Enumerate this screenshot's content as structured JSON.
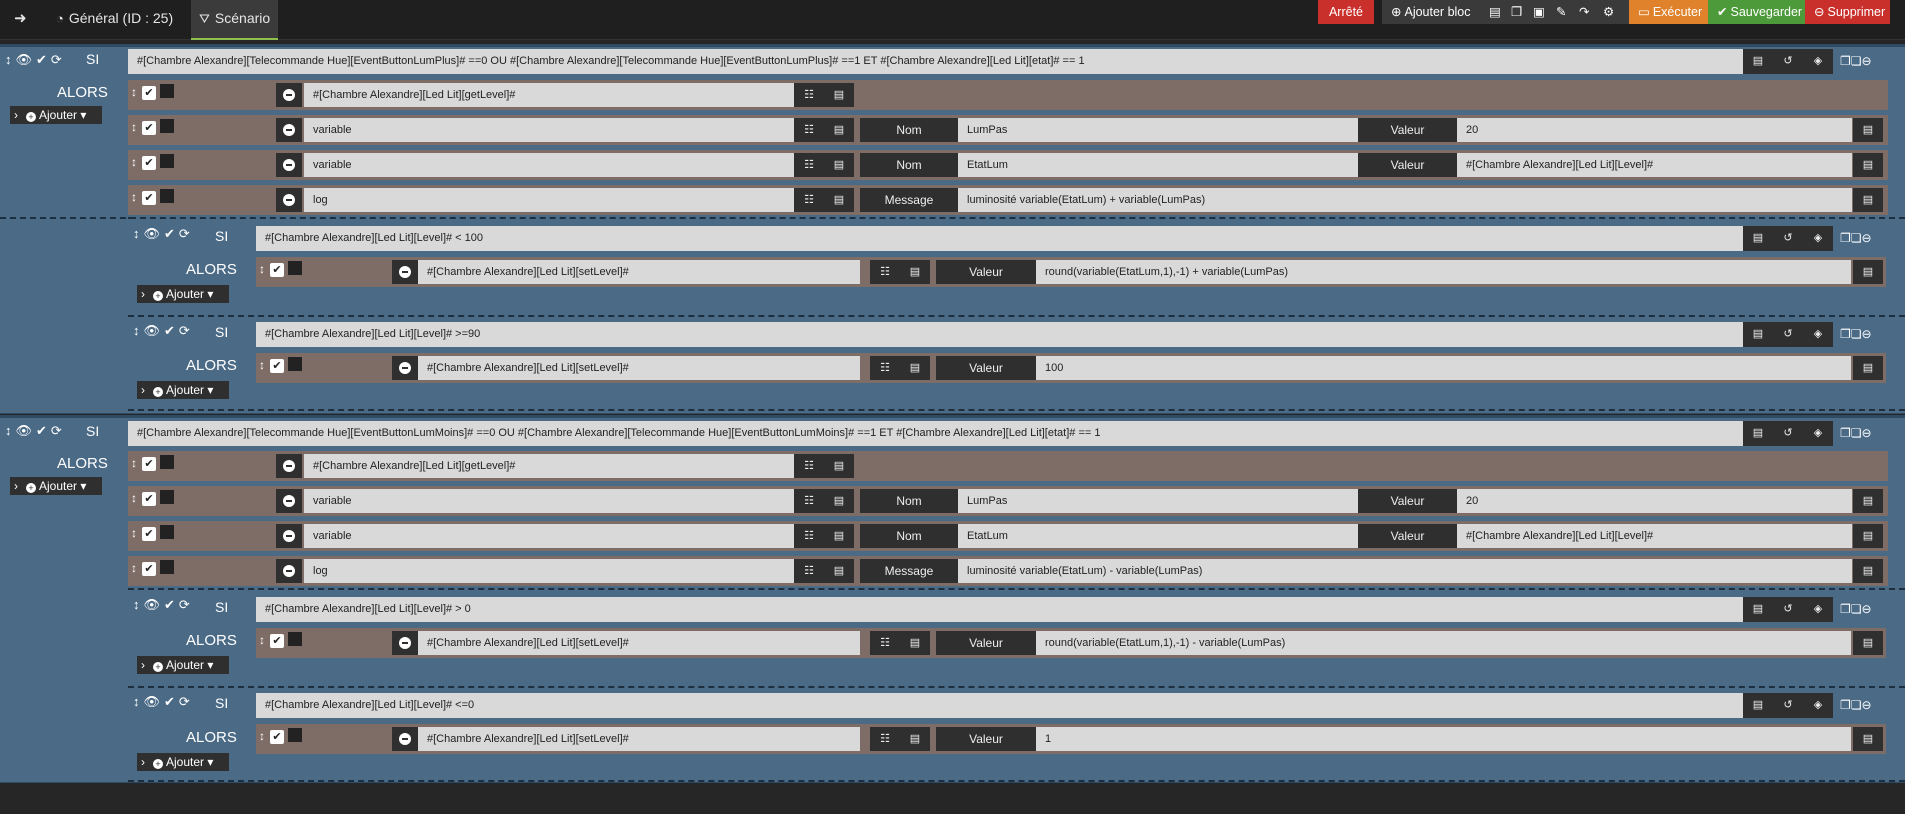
{
  "topbar": {
    "back_icon": "arrow-left-icon",
    "general_label": "Général (ID : 25)",
    "scenario_label": "Scénario",
    "status": "Arrêté",
    "add_block": "Ajouter bloc",
    "execute": "Exécuter",
    "save": "Sauvegarder",
    "delete": "Supprimer",
    "colors": {
      "status": "#c9302c",
      "execute": "#e0822b",
      "save": "#4c9a3a",
      "delete": "#c9302c"
    }
  },
  "labels": {
    "si": "SI",
    "alors": "ALORS",
    "add": "Ajouter",
    "nom": "Nom",
    "valeur": "Valeur",
    "message": "Message"
  },
  "blocks": [
    {
      "condition": "#[Chambre Alexandre][Telecommande Hue][EventButtonLumPlus]# ==0 OU #[Chambre Alexandre][Telecommande Hue][EventButtonLumPlus]# ==1 ET #[Chambre Alexandre][Led Lit][etat]# == 1",
      "actions": [
        {
          "cmd": "#[Chambre Alexandre][Led Lit][getLevel]#"
        },
        {
          "cmd": "variable",
          "nom": "LumPas",
          "valeur": "20"
        },
        {
          "cmd": "variable",
          "nom": "EtatLum",
          "valeur": "#[Chambre Alexandre][Led Lit][Level]#"
        },
        {
          "cmd": "log",
          "message": "luminosité variable(EtatLum) + variable(LumPas)"
        }
      ],
      "subs": [
        {
          "condition": "#[Chambre Alexandre][Led Lit][Level]# < 100",
          "action": {
            "cmd": "#[Chambre Alexandre][Led Lit][setLevel]#",
            "valeur": "round(variable(EtatLum,1),-1) + variable(LumPas)"
          }
        },
        {
          "condition": "#[Chambre Alexandre][Led Lit][Level]# >=90",
          "action": {
            "cmd": "#[Chambre Alexandre][Led Lit][setLevel]#",
            "valeur": "100"
          }
        }
      ]
    },
    {
      "condition": "#[Chambre Alexandre][Telecommande Hue][EventButtonLumMoins]# ==0 OU #[Chambre Alexandre][Telecommande Hue][EventButtonLumMoins]# ==1 ET #[Chambre Alexandre][Led Lit][etat]# == 1",
      "actions": [
        {
          "cmd": "#[Chambre Alexandre][Led Lit][getLevel]#"
        },
        {
          "cmd": "variable",
          "nom": "LumPas",
          "valeur": "20"
        },
        {
          "cmd": "variable",
          "nom": "EtatLum",
          "valeur": "#[Chambre Alexandre][Led Lit][Level]#"
        },
        {
          "cmd": "log",
          "message": "luminosité variable(EtatLum) - variable(LumPas)"
        }
      ],
      "subs": [
        {
          "condition": "#[Chambre Alexandre][Led Lit][Level]# > 0",
          "action": {
            "cmd": "#[Chambre Alexandre][Led Lit][setLevel]#",
            "valeur": "round(variable(EtatLum,1),-1) - variable(LumPas)"
          }
        },
        {
          "condition": "#[Chambre Alexandre][Led Lit][Level]# <=0",
          "action": {
            "cmd": "#[Chambre Alexandre][Led Lit][setLevel]#",
            "valeur": "1"
          }
        }
      ]
    }
  ]
}
